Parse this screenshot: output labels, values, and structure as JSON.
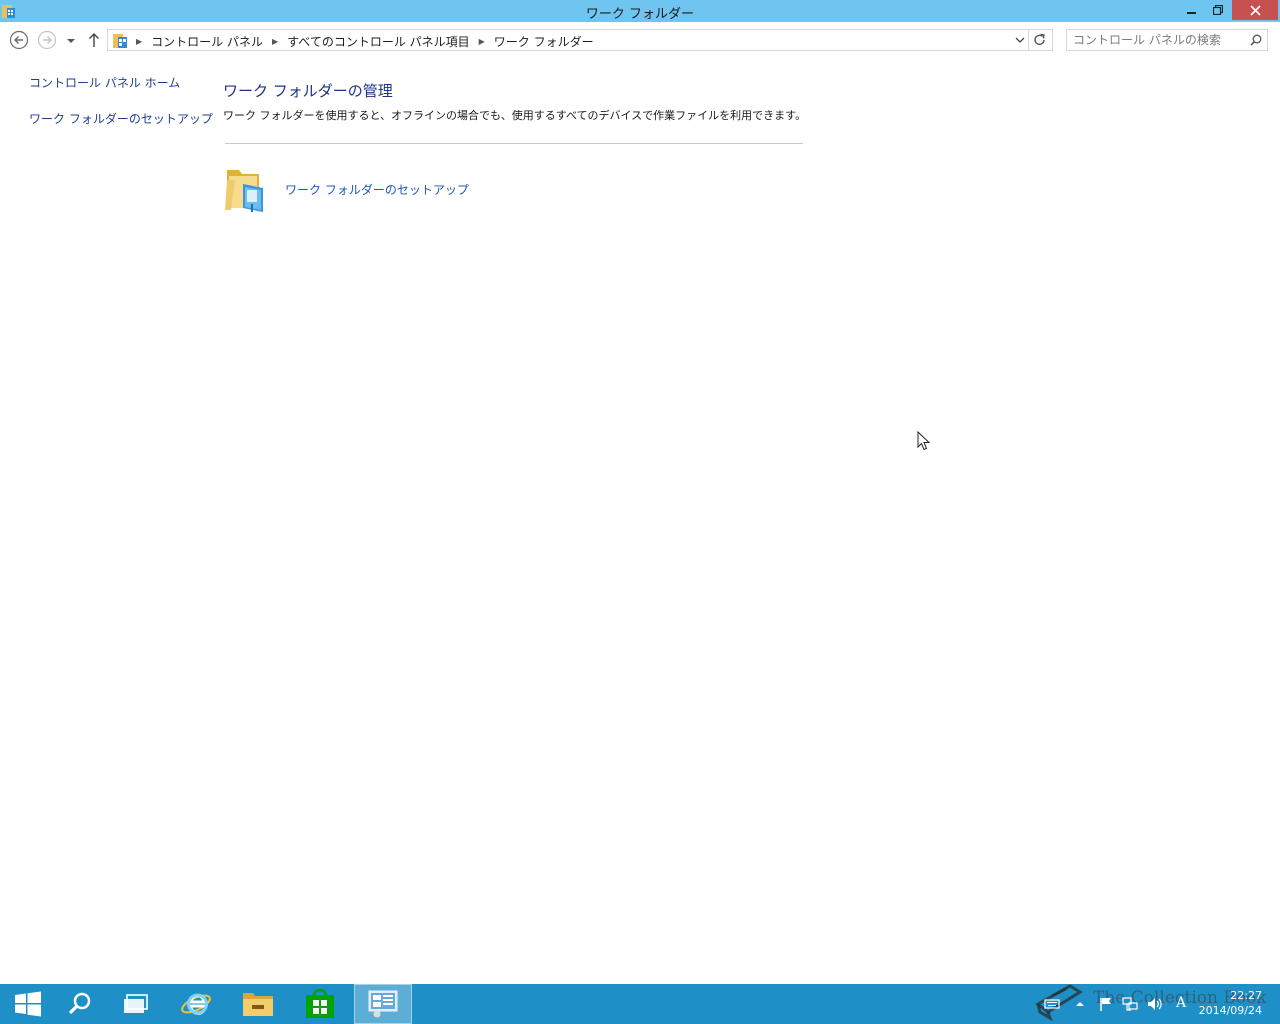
{
  "window": {
    "title": "ワーク フォルダー"
  },
  "address_bar": {
    "breadcrumbs": [
      "コントロール パネル",
      "すべてのコントロール パネル項目",
      "ワーク フォルダー"
    ],
    "search_placeholder": "コントロール パネルの検索"
  },
  "left_pane": {
    "links": [
      "コントロール パネル ホーム",
      "ワーク フォルダーのセットアップ"
    ]
  },
  "main": {
    "heading": "ワーク フォルダーの管理",
    "description": "ワーク フォルダーを使用すると、オフラインの場合でも、使用するすべてのデバイスで作業ファイルを利用できます。",
    "task_label": "ワーク フォルダーのセットアップ",
    "task_icon": "work-folders-icon"
  },
  "taskbar": {
    "items": [
      "start-icon",
      "search-icon",
      "task-view-icon",
      "internet-explorer-icon",
      "file-explorer-icon",
      "store-icon",
      "control-panel-icon"
    ],
    "active_item": "control-panel-icon",
    "clock_time": "22:27",
    "clock_date": "2014/09/24",
    "ime_indicator": "A",
    "watermark": "The Collection Book"
  },
  "colors": {
    "titlebar": "#6ec6f0",
    "close_button": "#c75050",
    "link": "#1e3f8f",
    "heading": "#1e3287",
    "taskbar": "#1f8fc7"
  }
}
